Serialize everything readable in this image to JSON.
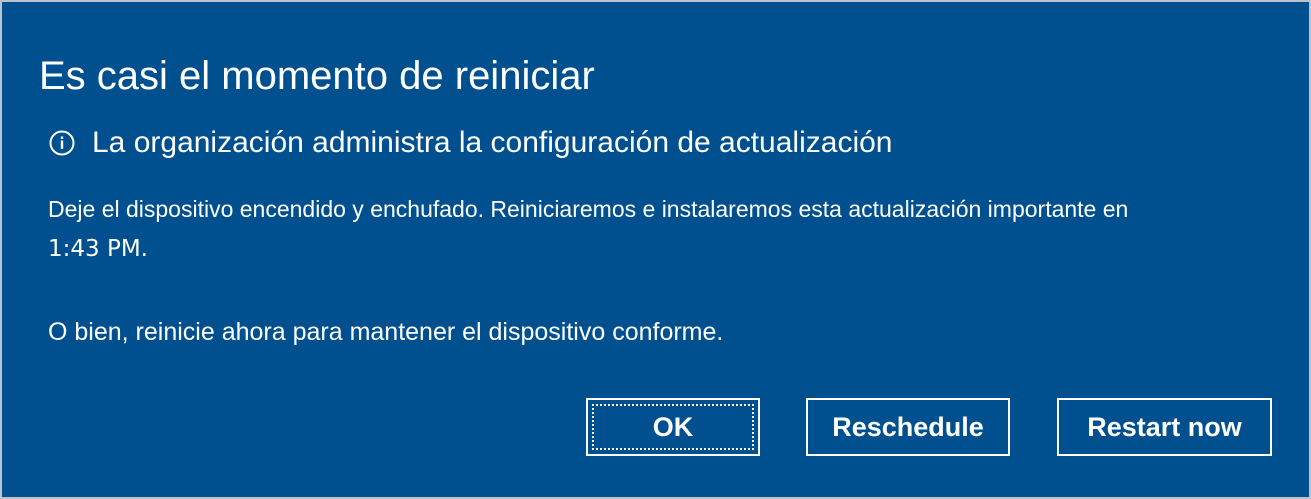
{
  "dialog": {
    "title": "Es casi el momento de reiniciar",
    "managed_notice": {
      "icon": "info-icon",
      "text": "La organización administra la configuración de actualización"
    },
    "message_line_1": "Deje el dispositivo encendido y enchufado. Reiniciaremos e instalaremos esta actualización importante en",
    "message_line_2": "1:43 PM.",
    "message_line_3": "O bien, reinicie ahora para mantener el dispositivo conforme."
  },
  "buttons": {
    "ok_label": "OK",
    "reschedule_label": "Reschedule",
    "restart_now_label": "Restart now"
  },
  "colors": {
    "background": "#00508f",
    "text": "#ffffff",
    "border": "#b9c4cf"
  }
}
